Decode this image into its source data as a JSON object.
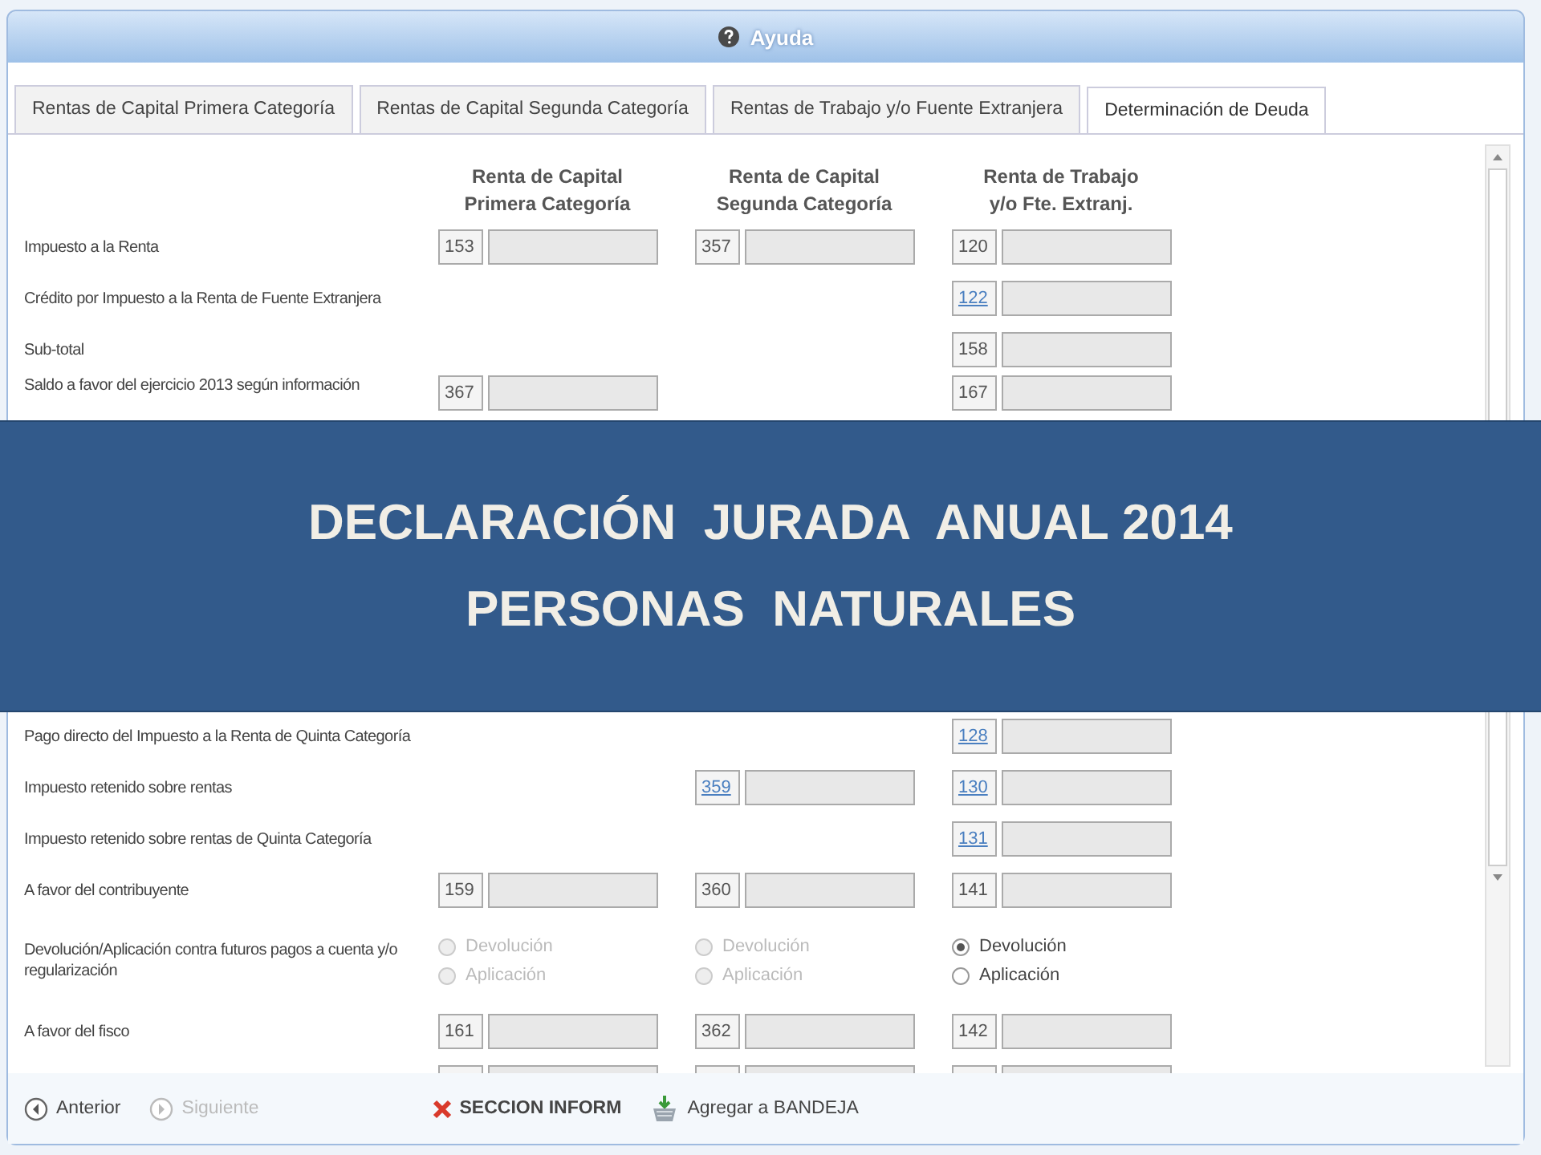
{
  "window": {
    "title": "Ayuda"
  },
  "tabs": [
    {
      "label": "Rentas de Capital Primera Categoría",
      "selected": false
    },
    {
      "label": "Rentas de Capital Segunda Categoría",
      "selected": false
    },
    {
      "label": "Rentas de Trabajo y/o Fuente Extranjera",
      "selected": false
    },
    {
      "label": "Determinación de Deuda",
      "selected": true
    }
  ],
  "columns": [
    {
      "line_1": "Renta de Capital",
      "line_2": "Primera Categoría"
    },
    {
      "line_1": "Renta de Capital",
      "line_2": "Segunda Categoría"
    },
    {
      "line_1": "Renta de Trabajo",
      "line_2": "y/o Fte. Extranj."
    }
  ],
  "rows": [
    {
      "kind": "fields",
      "label": "Impuesto a la Renta",
      "cells": [
        {
          "code": "153",
          "link": false
        },
        {
          "code": "357",
          "link": false
        },
        {
          "code": "120",
          "link": false
        }
      ]
    },
    {
      "kind": "fields",
      "label": "Crédito por Impuesto a la Renta de Fuente Extranjera",
      "cells": [
        null,
        null,
        {
          "code": "122",
          "link": true
        }
      ]
    },
    {
      "kind": "fields",
      "label": "Sub-total",
      "cells": [
        null,
        null,
        {
          "code": "158",
          "link": false
        }
      ]
    },
    {
      "kind": "fields",
      "label": "Saldo a favor del ejercicio 2013 según información",
      "cells": [
        {
          "code": "367",
          "link": false
        },
        null,
        {
          "code": "167",
          "link": false
        }
      ]
    },
    {
      "kind": "covered"
    },
    {
      "kind": "fields",
      "label": "Pago directo del Impuesto a la Renta de Quinta Categoría",
      "cells": [
        null,
        null,
        {
          "code": "128",
          "link": true
        }
      ]
    },
    {
      "kind": "fields",
      "label": "Impuesto retenido sobre rentas",
      "cells": [
        null,
        {
          "code": "359",
          "link": true
        },
        {
          "code": "130",
          "link": true
        }
      ]
    },
    {
      "kind": "fields",
      "label": "Impuesto retenido sobre rentas de Quinta Categoría",
      "cells": [
        null,
        null,
        {
          "code": "131",
          "link": true
        }
      ]
    },
    {
      "kind": "fields",
      "label": "A favor del contribuyente",
      "cells": [
        {
          "code": "159",
          "link": false
        },
        {
          "code": "360",
          "link": false
        },
        {
          "code": "141",
          "link": false
        }
      ]
    },
    {
      "kind": "choice",
      "label": "Devolución/Aplicación contra futuros pagos a cuenta y/o regularización",
      "cells": [
        {
          "disabled": true,
          "options": [
            {
              "label": "Devolución",
              "selected": false
            },
            {
              "label": "Aplicación",
              "selected": false
            }
          ]
        },
        {
          "disabled": true,
          "options": [
            {
              "label": "Devolución",
              "selected": false
            },
            {
              "label": "Aplicación",
              "selected": false
            }
          ]
        },
        {
          "disabled": false,
          "options": [
            {
              "label": "Devolución",
              "selected": true
            },
            {
              "label": "Aplicación",
              "selected": false
            }
          ]
        }
      ]
    },
    {
      "kind": "fields",
      "label": "A favor del fisco",
      "cells": [
        {
          "code": "161",
          "link": false
        },
        {
          "code": "362",
          "link": false
        },
        {
          "code": "142",
          "link": false
        }
      ]
    },
    {
      "kind": "partial"
    }
  ],
  "footer": [
    {
      "kind": "back",
      "label": "Anterior",
      "disabled": false
    },
    {
      "kind": "next",
      "label": "Siguiente",
      "disabled": true
    },
    {
      "kind": "close",
      "label": "SECCION INFORM",
      "disabled": false
    },
    {
      "kind": "tray",
      "label": "Agregar a BANDEJA",
      "disabled": false
    }
  ],
  "banner": {
    "line_1": "DECLARACIÓN  JURADA  ANUAL 2014",
    "line_2": "PERSONAS  NATURALES"
  }
}
